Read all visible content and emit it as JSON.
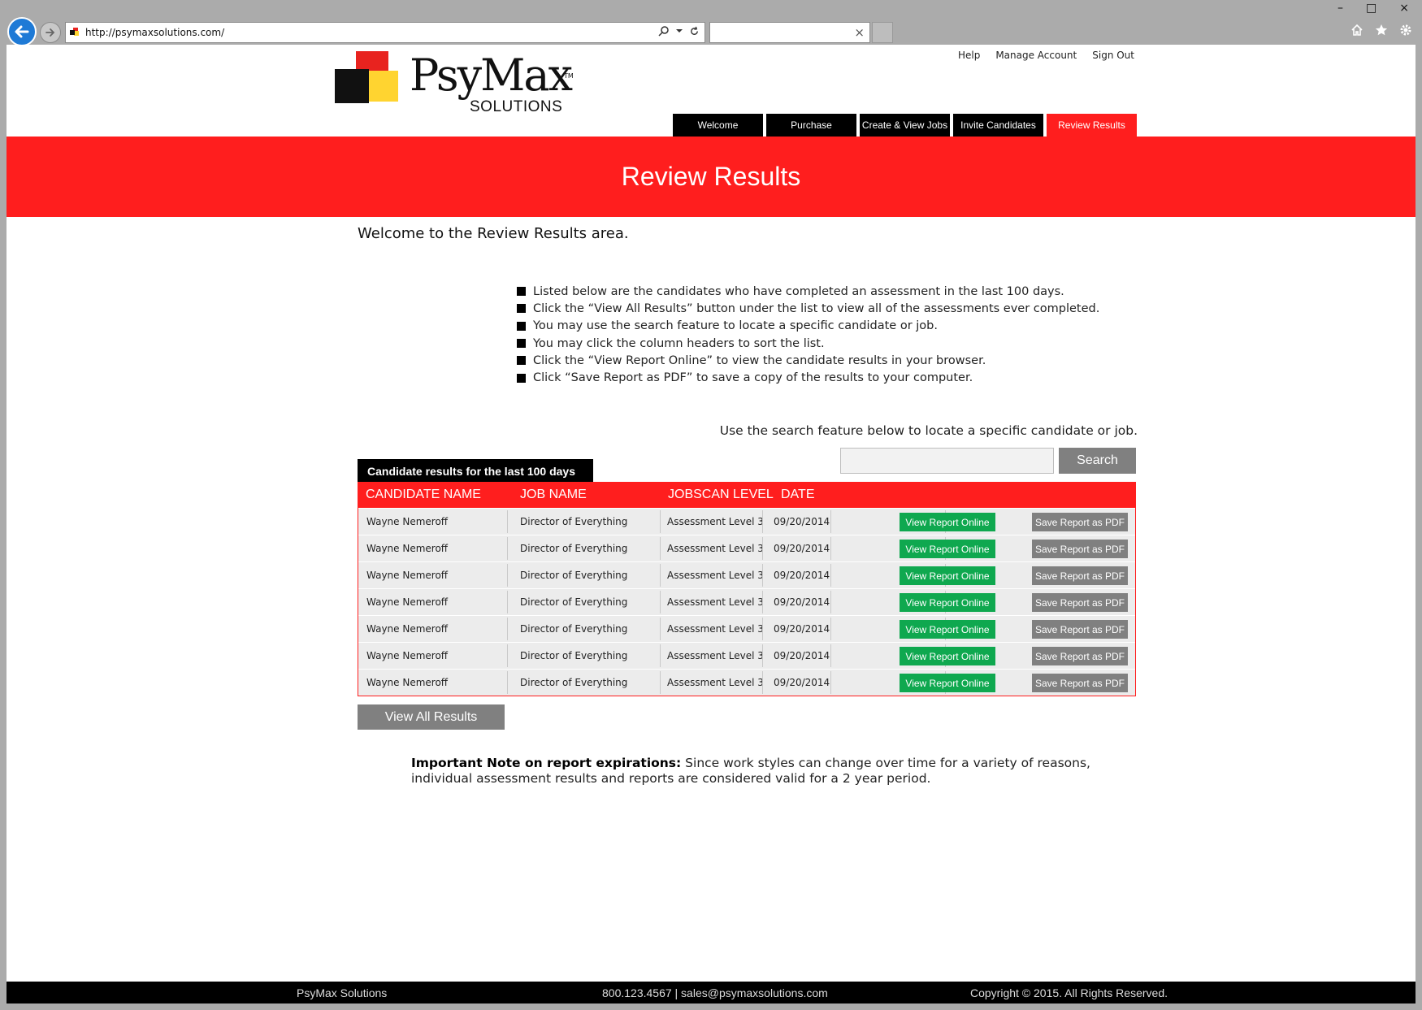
{
  "browser": {
    "url": "http://psymaxsolutions.com/",
    "tab_title": "",
    "close_glyph": "×",
    "window_controls": [
      "–",
      "□",
      "×"
    ],
    "toolbar_icons": [
      "home-icon",
      "star-icon",
      "gear-icon"
    ]
  },
  "header": {
    "logo_name": "PsyMax",
    "logo_sub": "SOLUTIONS",
    "logo_tm": "TM",
    "util_links": [
      "Help",
      "Manage Account",
      "Sign Out"
    ],
    "nav": [
      {
        "label": "Welcome",
        "active": false
      },
      {
        "label": "Purchase",
        "active": false
      },
      {
        "label": "Create & View Jobs",
        "active": false
      },
      {
        "label": "Invite Candidates",
        "active": false
      },
      {
        "label": "Review Results",
        "active": true
      }
    ]
  },
  "banner": {
    "title": "Review Results"
  },
  "intro": {
    "welcome": "Welcome to the Review Results area.",
    "instructions": [
      "Listed below are the candidates who have completed an assessment in the last 100 days.",
      "Click the “View All Results” button under the list to view all of the assessments ever completed.",
      "You may use the search feature to locate a specific candidate or job.",
      "You may click the column headers to sort the list.",
      "Click the “View Report Online” to view the candidate results in your browser.",
      "Click “Save Report as PDF” to save a copy of the results to your computer."
    ]
  },
  "search": {
    "hint": "Use the search feature below to locate a specific candidate or job.",
    "value": "",
    "placeholder": "",
    "button": "Search"
  },
  "results": {
    "label": "Candidate results for the last 100 days",
    "columns": [
      "CANDIDATE NAME",
      "JOB NAME",
      "JOBSCAN LEVEL",
      "DATE"
    ],
    "view_button": "View Report Online",
    "pdf_button": "Save Report as PDF",
    "rows": [
      {
        "name": "Wayne Nemeroff",
        "job": "Director of Everything",
        "level": "Assessment Level 3",
        "date": "09/20/2014"
      },
      {
        "name": "Wayne Nemeroff",
        "job": "Director of Everything",
        "level": "Assessment Level 3",
        "date": "09/20/2014"
      },
      {
        "name": "Wayne Nemeroff",
        "job": "Director of Everything",
        "level": "Assessment Level 3",
        "date": "09/20/2014"
      },
      {
        "name": "Wayne Nemeroff",
        "job": "Director of Everything",
        "level": "Assessment Level 3",
        "date": "09/20/2014"
      },
      {
        "name": "Wayne Nemeroff",
        "job": "Director of Everything",
        "level": "Assessment Level 3",
        "date": "09/20/2014"
      },
      {
        "name": "Wayne Nemeroff",
        "job": "Director of Everything",
        "level": "Assessment Level 3",
        "date": "09/20/2014"
      },
      {
        "name": "Wayne Nemeroff",
        "job": "Director of Everything",
        "level": "Assessment Level 3",
        "date": "09/20/2014"
      }
    ],
    "view_all": "View All Results"
  },
  "note": {
    "heading": "Important Note on report expirations:",
    "body": " Since work styles can change over time for a variety of reasons, individual assessment results and reports are considered valid for a 2 year period."
  },
  "footer": {
    "company": "PsyMax Solutions",
    "contact": "800.123.4567 | sales@psymaxsolutions.com",
    "copyright": "Copyright © 2015. All Rights Reserved."
  },
  "colors": {
    "brand_red": "#ff1e1e",
    "brand_yellow": "#ffd430",
    "view_green": "#0fa84f",
    "button_gray": "#808080"
  }
}
